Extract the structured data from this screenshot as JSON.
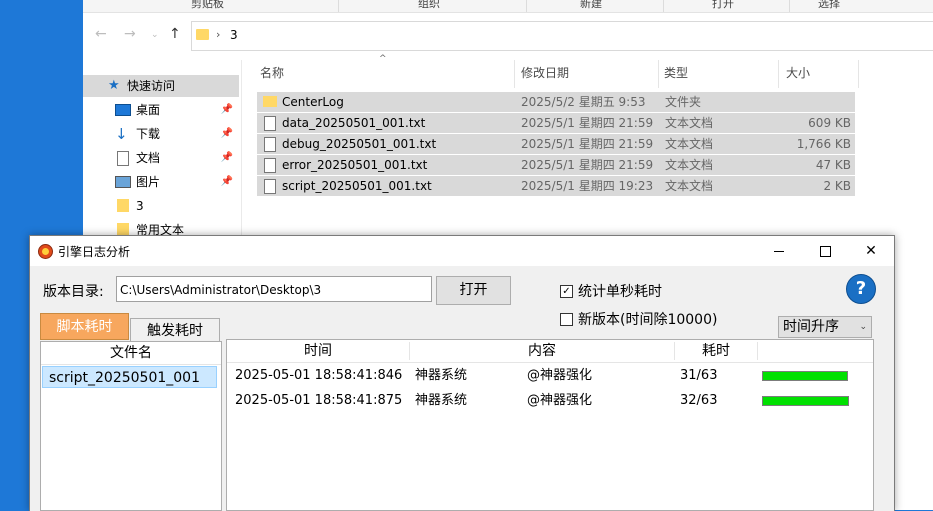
{
  "explorer": {
    "ribbon": [
      "剪贴板",
      "组织",
      "新建",
      "打开",
      "选择"
    ],
    "address": "3",
    "nav": [
      {
        "label": "快速访问",
        "icon": "star-icon",
        "pinned": false
      },
      {
        "label": "桌面",
        "icon": "desktop-icon",
        "pinned": true
      },
      {
        "label": "下载",
        "icon": "download-icon",
        "pinned": true
      },
      {
        "label": "文档",
        "icon": "document-icon",
        "pinned": true
      },
      {
        "label": "图片",
        "icon": "picture-icon",
        "pinned": true
      },
      {
        "label": "3",
        "icon": "folder-icon",
        "pinned": false
      },
      {
        "label": "常用文本",
        "icon": "folder-icon",
        "pinned": false
      }
    ],
    "columns": {
      "name": "名称",
      "date": "修改日期",
      "type": "类型",
      "size": "大小"
    },
    "files": [
      {
        "name": "CenterLog",
        "date": "2025/5/2 星期五 9:53",
        "type": "文件夹",
        "size": "",
        "icon": "folder-icon"
      },
      {
        "name": "data_20250501_001.txt",
        "date": "2025/5/1 星期四 21:59",
        "type": "文本文档",
        "size": "609 KB",
        "icon": "text-file-icon"
      },
      {
        "name": "debug_20250501_001.txt",
        "date": "2025/5/1 星期四 21:59",
        "type": "文本文档",
        "size": "1,766 KB",
        "icon": "text-file-icon"
      },
      {
        "name": "error_20250501_001.txt",
        "date": "2025/5/1 星期四 21:59",
        "type": "文本文档",
        "size": "47 KB",
        "icon": "text-file-icon"
      },
      {
        "name": "script_20250501_001.txt",
        "date": "2025/5/1 星期四 19:23",
        "type": "文本文档",
        "size": "2 KB",
        "icon": "text-file-icon"
      }
    ]
  },
  "dialog": {
    "title": "引擎日志分析",
    "version_dir_label": "版本目录:",
    "path_value": "C:\\Users\\Administrator\\Desktop\\3",
    "open_label": "打开",
    "opt_per_second": {
      "label": "统计单秒耗时",
      "checked": true
    },
    "opt_new_version": {
      "label": "新版本(时间除10000)",
      "checked": false
    },
    "help_label": "?",
    "sort_label": "时间升序",
    "tabs": [
      "脚本耗时",
      "触发耗时"
    ],
    "active_tab": 0,
    "file_list_header": "文件名",
    "file_list": [
      "script_20250501_001"
    ],
    "grid_columns": [
      "时间",
      "内容",
      "耗时"
    ],
    "rows": [
      {
        "time": "2025-05-01 18:58:41:846",
        "system": "神器系统",
        "content": "@神器强化",
        "cost": "31/63",
        "ratio": 0.984
      },
      {
        "time": "2025-05-01 18:58:41:875",
        "system": "神器系统",
        "content": "@神器强化",
        "cost": "32/63",
        "ratio": 1.0
      }
    ],
    "bar_color": "#00e000",
    "tab_active_color": "#f7a75e"
  }
}
